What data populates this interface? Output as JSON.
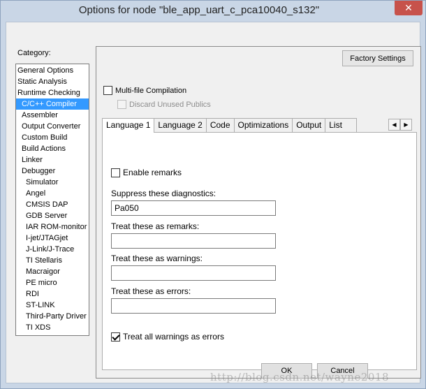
{
  "window": {
    "title": "Options for node \"ble_app_uart_c_pca10040_s132\"",
    "close_glyph": "✕"
  },
  "category": {
    "label": "Category:",
    "items": [
      {
        "label": "General Options",
        "level": 0
      },
      {
        "label": "Static Analysis",
        "level": 0
      },
      {
        "label": "Runtime Checking",
        "level": 0
      },
      {
        "label": "C/C++ Compiler",
        "level": 1,
        "selected": true
      },
      {
        "label": "Assembler",
        "level": 1
      },
      {
        "label": "Output Converter",
        "level": 1
      },
      {
        "label": "Custom Build",
        "level": 1
      },
      {
        "label": "Build Actions",
        "level": 1
      },
      {
        "label": "Linker",
        "level": 1
      },
      {
        "label": "Debugger",
        "level": 1
      },
      {
        "label": "Simulator",
        "level": 2
      },
      {
        "label": "Angel",
        "level": 2
      },
      {
        "label": "CMSIS DAP",
        "level": 2
      },
      {
        "label": "GDB Server",
        "level": 2
      },
      {
        "label": "IAR ROM-monitor",
        "level": 2
      },
      {
        "label": "I-jet/JTAGjet",
        "level": 2
      },
      {
        "label": "J-Link/J-Trace",
        "level": 2
      },
      {
        "label": "TI Stellaris",
        "level": 2
      },
      {
        "label": "Macraigor",
        "level": 2
      },
      {
        "label": "PE micro",
        "level": 2
      },
      {
        "label": "RDI",
        "level": 2
      },
      {
        "label": "ST-LINK",
        "level": 2
      },
      {
        "label": "Third-Party Driver",
        "level": 2
      },
      {
        "label": "TI XDS",
        "level": 2
      }
    ]
  },
  "panel": {
    "factory_settings": "Factory Settings",
    "multi_file": {
      "label": "Multi-file Compilation",
      "checked": false
    },
    "discard_unused": {
      "label": "Discard Unused Publics",
      "checked": false,
      "disabled": true
    },
    "tabs": [
      "Language 1",
      "Language 2",
      "Code",
      "Optimizations",
      "Output",
      "List"
    ],
    "active_tab": "Language 1",
    "scroll_left": "◀",
    "scroll_right": "▶",
    "page": {
      "enable_remarks": {
        "label": "Enable remarks",
        "checked": false
      },
      "suppress": {
        "label": "Suppress these diagnostics:",
        "value": "Pa050"
      },
      "remarks": {
        "label": "Treat these as remarks:",
        "value": ""
      },
      "warnings": {
        "label": "Treat these as warnings:",
        "value": ""
      },
      "errors": {
        "label": "Treat these as errors:",
        "value": ""
      },
      "all_warnings_errors": {
        "label": "Treat all warnings as errors",
        "checked": true
      }
    }
  },
  "buttons": {
    "ok": "OK",
    "cancel": "Cancel"
  },
  "watermark": "http://blog.csdn.net/wayne2018"
}
